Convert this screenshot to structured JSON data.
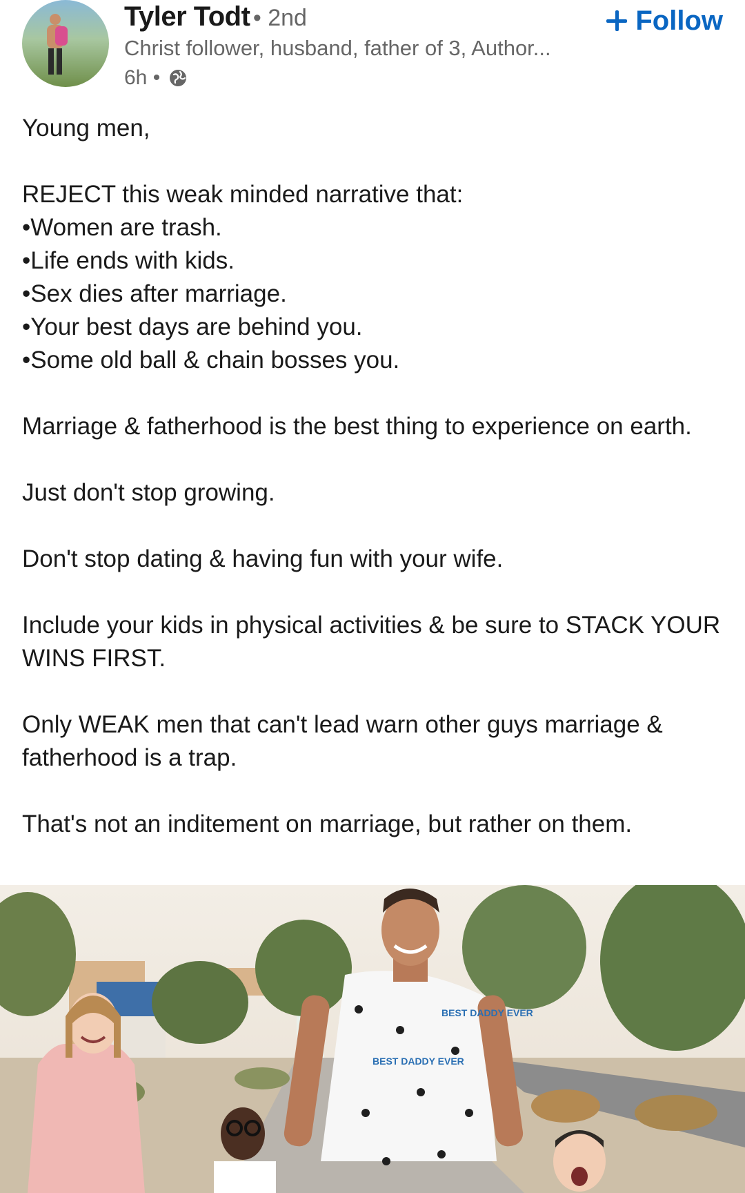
{
  "author": {
    "name": "Tyler Todt",
    "degree": "• 2nd",
    "headline": "Christ follower, husband, father of 3, Author...",
    "time": "6h •"
  },
  "actions": {
    "follow_label": "Follow"
  },
  "icons": {
    "avatar": "profile-photo",
    "follow": "plus-icon",
    "visibility": "globe-icon"
  },
  "colors": {
    "accent": "#0a66c2",
    "text": "#1a1a1a",
    "muted": "#666666"
  },
  "post": {
    "greeting": "Young men,",
    "reject_intro": "REJECT this weak minded narrative that:",
    "bullets": [
      "•Women are trash.",
      "•Life ends with kids.",
      "•Sex dies after marriage.",
      "•Your best days are behind you.",
      "•Some old ball & chain bosses you."
    ],
    "p1": "Marriage & fatherhood is the best thing to experience on earth.",
    "p2": "Just don't stop growing.",
    "p3": "Don't stop dating & having fun with your wife.",
    "p4": "Include your kids in physical activities & be sure to STACK YOUR WINS FIRST.",
    "p5": "Only WEAK men that can't lead warn other guys marriage & fatherhood is a trap.",
    "p6": "That's not an inditement on marriage, but rather on them."
  },
  "image": {
    "shirt_text": "BEST DADDY EVER"
  }
}
